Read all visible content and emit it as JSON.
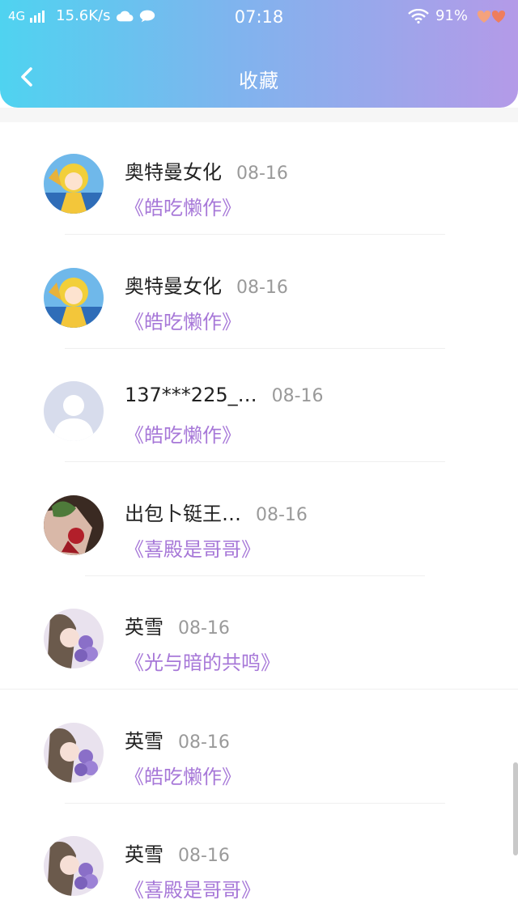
{
  "status": {
    "network": "4G",
    "speed": "15.6K/s",
    "time": "07:18",
    "battery": "91%"
  },
  "header": {
    "title": "收藏"
  },
  "items": [
    {
      "name": "奥特曼女化",
      "date": "08-16",
      "book": "《皓吃懒作》",
      "avatar": "anime-girl-yellow"
    },
    {
      "name": "奥特曼女化",
      "date": "08-16",
      "book": "《皓吃懒作》",
      "avatar": "anime-girl-yellow"
    },
    {
      "name": "137***225_…",
      "date": "08-16",
      "book": "《皓吃懒作》",
      "avatar": "default-user"
    },
    {
      "name": "出包卜铤王…",
      "date": "08-16",
      "book": "《喜殿是哥哥》",
      "avatar": "hand-rose"
    },
    {
      "name": "英雪",
      "date": "08-16",
      "book": "《光与暗的共鸣》",
      "avatar": "anime-girl-flowers"
    },
    {
      "name": "英雪",
      "date": "08-16",
      "book": "《皓吃懒作》",
      "avatar": "anime-girl-flowers"
    },
    {
      "name": "英雪",
      "date": "08-16",
      "book": "《喜殿是哥哥》",
      "avatar": "anime-girl-flowers"
    }
  ],
  "colors": {
    "header_start": "#4fd3f0",
    "header_end": "#b49ae8",
    "book_title": "#a778d8",
    "date": "#9a9a9a"
  }
}
